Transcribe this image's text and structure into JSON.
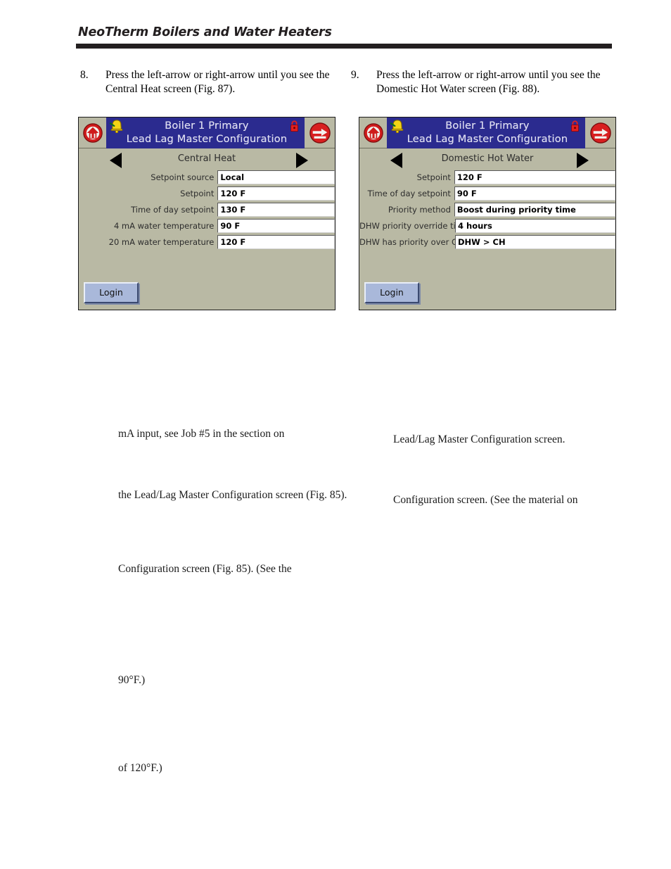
{
  "header": {
    "title": "NeoTherm Boilers and Water Heaters"
  },
  "steps": [
    {
      "number": "8.",
      "text": "Press the left-arrow or right-arrow until you see the Central Heat screen (Fig. 87)."
    },
    {
      "number": "9.",
      "text": "Press the left-arrow or right-arrow until you see the Domestic Hot Water screen (Fig. 88)."
    }
  ],
  "devices": [
    {
      "id": "central-heat",
      "titlebar": {
        "line1": "Boiler 1 Primary",
        "line2": "Lead Lag Master Configuration",
        "home_icon": "home-icon",
        "bell_icon": "bell-icon",
        "lock_icon": "lock-icon",
        "back_icon": "back-icon",
        "background": "#2b2b8f"
      },
      "nav": {
        "left_arrow": "left-arrow-icon",
        "right_arrow": "right-arrow-icon",
        "title": "Central Heat"
      },
      "fields": [
        {
          "label": "Setpoint source",
          "value": "Local"
        },
        {
          "label": "Setpoint",
          "value": "120 F"
        },
        {
          "label": "Time of day setpoint",
          "value": "130 F"
        },
        {
          "label": "4 mA water temperature",
          "value": "90 F"
        },
        {
          "label": "20 mA water temperature",
          "value": "120 F"
        }
      ],
      "login_label": "Login"
    },
    {
      "id": "domestic-hot-water",
      "titlebar": {
        "line1": "Boiler 1 Primary",
        "line2": "Lead Lag Master Configuration",
        "home_icon": "home-icon",
        "bell_icon": "bell-icon",
        "lock_icon": "lock-icon",
        "back_icon": "back-icon",
        "background": "#2b2b8f"
      },
      "nav": {
        "left_arrow": "left-arrow-icon",
        "right_arrow": "right-arrow-icon",
        "title": "Domestic Hot Water"
      },
      "fields": [
        {
          "label": "Setpoint",
          "value": "120 F"
        },
        {
          "label": "Time of day setpoint",
          "value": "90 F"
        },
        {
          "label": "Priority method",
          "value": "Boost during priority time"
        },
        {
          "label": "DHW priority override time",
          "value": "4 hours"
        },
        {
          "label": "DHW has priority over CH?",
          "value": "DHW > CH"
        }
      ],
      "login_label": "Login"
    }
  ],
  "body_fragments": {
    "left": [
      "mA input, see Job #5 in the section on",
      "the Lead/Lag Master Configuration screen (Fig. 85).",
      "Configuration screen (Fig. 85). (See the",
      "90°F.)",
      "of 120°F.)"
    ],
    "right": [
      "Lead/Lag Master Configuration screen.",
      "Configuration screen. (See the material on"
    ]
  },
  "colors": {
    "screen_background": "#b9b9a4",
    "titlebar_blue": "#2b2b8f",
    "title_text": "#dcdcf0",
    "login_button": "#a9b8da",
    "rule": "#231f20"
  }
}
